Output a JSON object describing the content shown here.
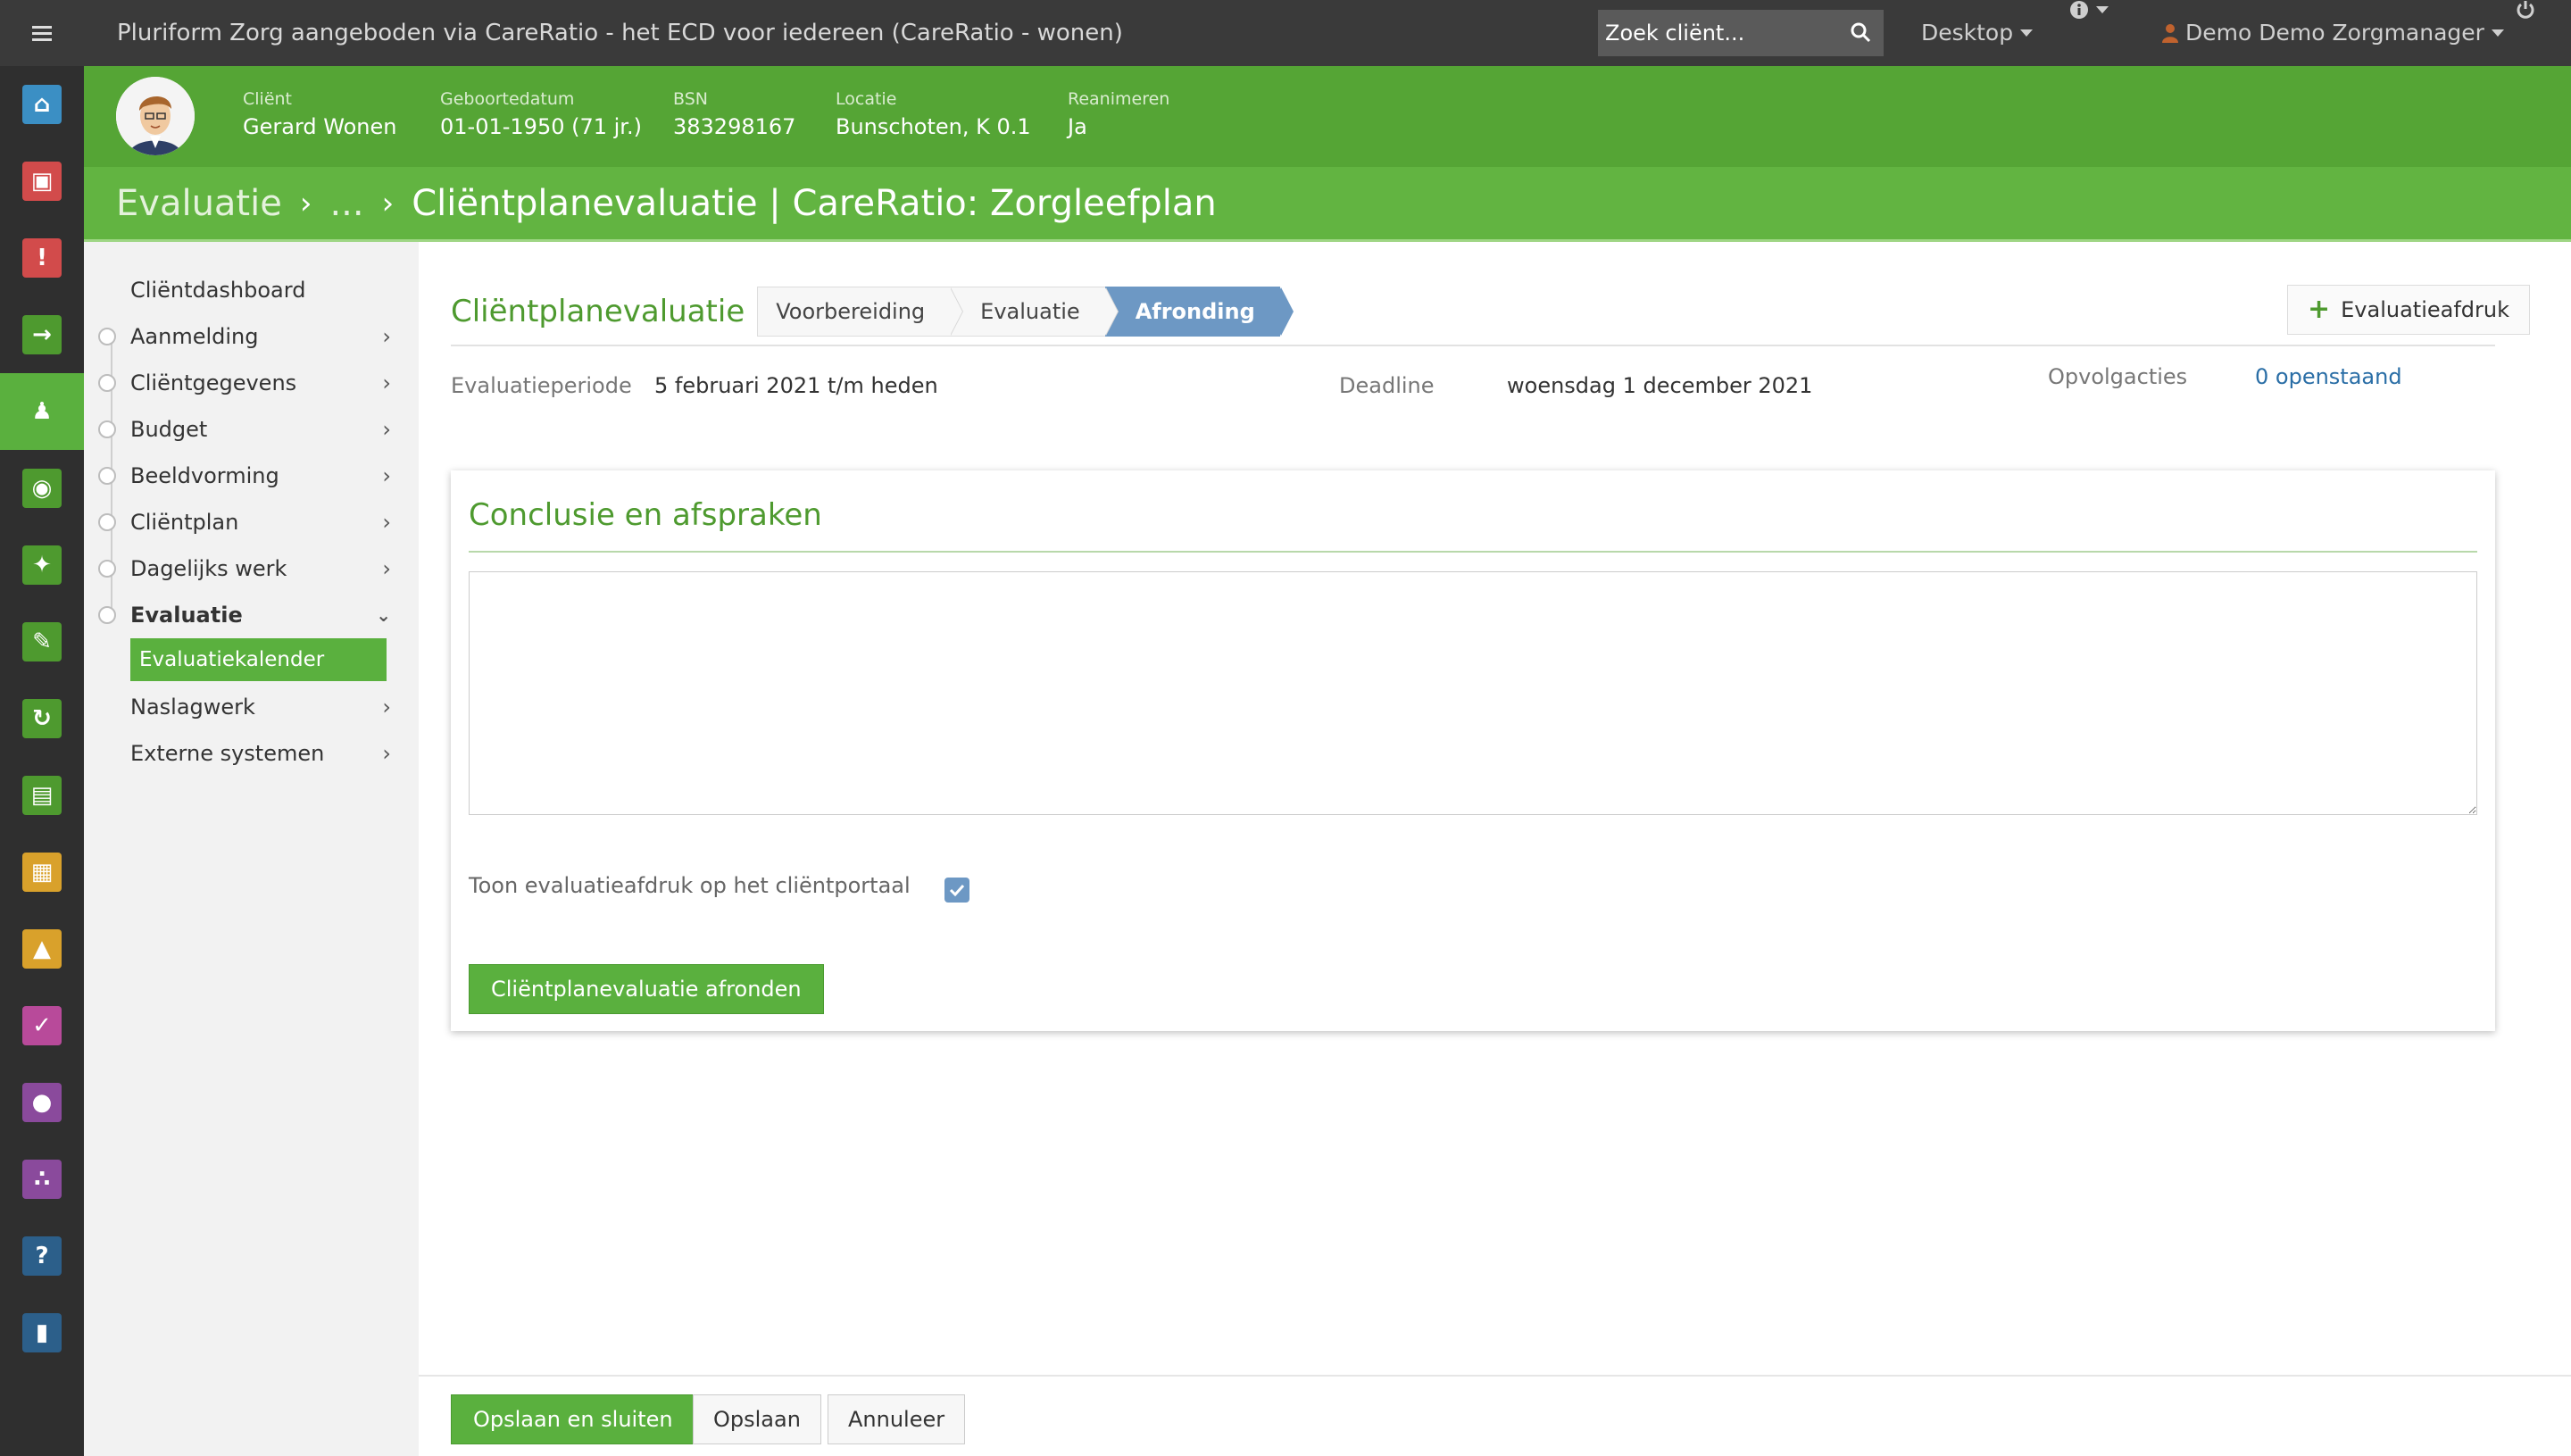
{
  "topbar": {
    "app_title": "Pluriform Zorg aangeboden via CareRatio - het ECD voor iedereen  (CareRatio - wonen)",
    "search_placeholder": "Zoek cliënt...",
    "desktop_label": "Desktop",
    "user_label": "Demo Demo Zorgmanager"
  },
  "rail": {
    "items": [
      {
        "icon": "home-icon",
        "color": "#3b8fc4"
      },
      {
        "icon": "inbox-icon",
        "color": "#d24b4b"
      },
      {
        "icon": "warning-icon",
        "color": "#d24b4b"
      },
      {
        "icon": "login-icon",
        "color": "#4e9a2f"
      },
      {
        "icon": "client-icon",
        "color": "#5ab03e",
        "active": true
      },
      {
        "icon": "money-icon",
        "color": "#4e9a2f"
      },
      {
        "icon": "puzzle-icon",
        "color": "#4e9a2f"
      },
      {
        "icon": "pencil-icon",
        "color": "#4e9a2f"
      },
      {
        "icon": "refresh-icon",
        "color": "#4e9a2f"
      },
      {
        "icon": "document-icon",
        "color": "#4e9a2f"
      },
      {
        "icon": "calendar-icon",
        "color": "#d9a12b"
      },
      {
        "icon": "road-icon",
        "color": "#d9a12b"
      },
      {
        "icon": "check-icon",
        "color": "#b84a9a"
      },
      {
        "icon": "user-icon",
        "color": "#8a4a9c"
      },
      {
        "icon": "group-icon",
        "color": "#8a4a9c"
      },
      {
        "icon": "help-icon",
        "color": "#2c5f8a"
      },
      {
        "icon": "chart-icon",
        "color": "#2c5f8a"
      }
    ]
  },
  "client": {
    "fields": [
      {
        "label": "Cliënt",
        "value": "Gerard Wonen"
      },
      {
        "label": "Geboortedatum",
        "value": "01-01-1950 (71 jr.)"
      },
      {
        "label": "BSN",
        "value": "383298167"
      },
      {
        "label": "Locatie",
        "value": "Bunschoten, K 0.1"
      },
      {
        "label": "Reanimeren",
        "value": "Ja"
      }
    ]
  },
  "breadcrumb": {
    "parent": "Evaluatie",
    "ellipsis": "...",
    "current": "Cliëntplanevaluatie | CareRatio: Zorgleefplan"
  },
  "sidenav": {
    "items": [
      {
        "label": "Cliëntdashboard"
      },
      {
        "label": "Aanmelding"
      },
      {
        "label": "Cliëntgegevens"
      },
      {
        "label": "Budget"
      },
      {
        "label": "Beeldvorming"
      },
      {
        "label": "Cliëntplan"
      },
      {
        "label": "Dagelijks werk"
      },
      {
        "label": "Evaluatie"
      },
      {
        "label": "Naslagwerk"
      },
      {
        "label": "Externe systemen"
      }
    ],
    "sub_active": "Evaluatiekalender"
  },
  "main": {
    "page_title": "Cliëntplanevaluatie",
    "steps": [
      "Voorbereiding",
      "Evaluatie",
      "Afronding"
    ],
    "active_step": "Afronding",
    "print_button": "Evaluatieafdruk",
    "period_label": "Evaluatieperiode",
    "period_value": "5 februari 2021 t/m heden",
    "deadline_label": "Deadline",
    "deadline_value": "woensdag 1 december 2021",
    "followup_label": "Opvolgacties",
    "followup_value": "0 openstaand"
  },
  "panel": {
    "title": "Conclusie en afspraken",
    "textarea_value": "",
    "checkbox_label": "Toon evaluatieafdruk op het cliëntportaal",
    "checkbox_checked": true,
    "finish_button": "Cliëntplanevaluatie afronden"
  },
  "footer": {
    "save_close": "Opslaan en sluiten",
    "save": "Opslaan",
    "cancel": "Annuleer"
  }
}
